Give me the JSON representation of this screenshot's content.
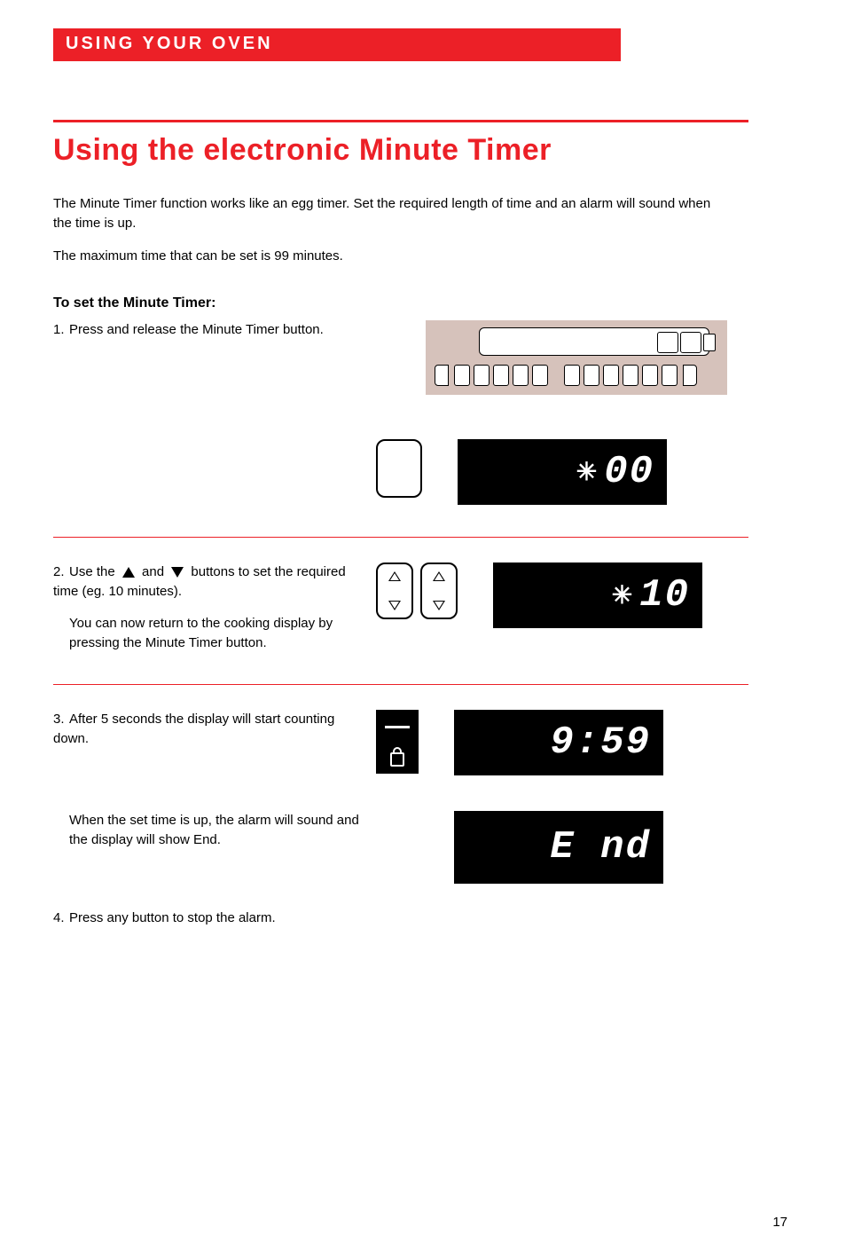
{
  "chapter": "USING YOUR OVEN",
  "title": "Using the electronic Minute Timer",
  "intro1": "The Minute Timer function works like an egg timer. Set the required length of time and an alarm will sound when the time is up.",
  "intro2": "The maximum time that can be set is 99 minutes.",
  "subhead": "To set the Minute Timer:",
  "step1": {
    "n": "1.",
    "text": "Press and release the Minute Timer button."
  },
  "step2": {
    "n": "2.",
    "pre": "Use the ",
    "mid": " and ",
    "post": " buttons to set the required time (eg. 10 minutes).",
    "after": "You can now return to the cooking display by pressing the Minute Timer button."
  },
  "step3": {
    "n": "3.",
    "text": "After 5 seconds the display will start counting down.",
    "after": "When the set time is up, the alarm will sound and the display will show End."
  },
  "step4": {
    "n": "4.",
    "text": "Press any button to stop the alarm."
  },
  "displays": {
    "d1": "00",
    "d2": "10",
    "d3": "9:59",
    "d4": "E nd"
  },
  "page_number": "17"
}
